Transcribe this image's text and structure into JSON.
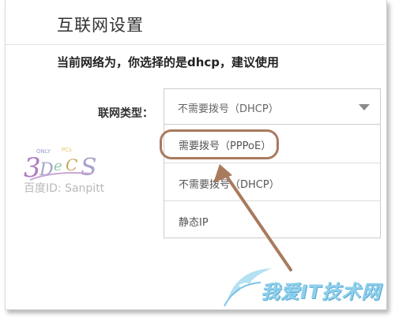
{
  "page": {
    "title": "互联网设置",
    "notice": "当前网络为，你选择的是dhcp，建议使用"
  },
  "form": {
    "connection_type_label": "联网类型：",
    "selected_value": "不需要拨号（DHCP）",
    "options": [
      "需要拨号（PPPoE）",
      "不需要拨号（DHCP）",
      "静态IP"
    ]
  },
  "watermark": {
    "logo_caption": "百度ID: Sanpitt",
    "site_text": "我爱IT技术网"
  },
  "colors": {
    "annotation": "#a97a5e",
    "watermark": "#8fd0ec"
  }
}
